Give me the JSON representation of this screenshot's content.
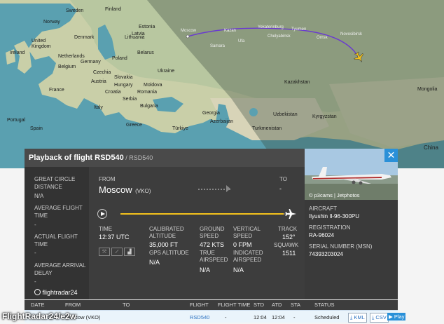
{
  "map_labels": {
    "sweden": "Sweden",
    "finland": "Finland",
    "norway": "Norway",
    "estonia": "Estonia",
    "denmark": "Denmark",
    "latvia": "Latvia",
    "lithuania": "Lithuania",
    "united_kingdom": "United\nKingdom",
    "ireland": "Ireland",
    "netherlands": "Netherlands",
    "belarus": "Belarus",
    "poland": "Poland",
    "germany": "Germany",
    "belgium": "Belgium",
    "czechia": "Czechia",
    "ukraine": "Ukraine",
    "slovakia": "Slovakia",
    "austria": "Austria",
    "hungary": "Hungary",
    "moldova": "Moldova",
    "france": "France",
    "croatia": "Croatia",
    "romania": "Romania",
    "serbia": "Serbia",
    "bulgaria": "Bulgaria",
    "italy": "Italy",
    "portugal": "Portugal",
    "spain": "Spain",
    "greece": "Greece",
    "turkiye": "Türkiye",
    "georgia": "Georgia",
    "azerbaijan": "Azerbaijan",
    "turkmenistan": "Turkmenistan",
    "uzbekistan": "Uzbekistan",
    "kyrgyzstan": "Kyrgyzstan",
    "kazakhstan": "Kazakhstan",
    "mongolia": "Mongolia",
    "china": "China",
    "moscow": "Moscow",
    "kazan": "Kazan",
    "yekaterinburg": "Yekaterinburg",
    "chelyabinsk": "Chelyabinsk",
    "tyumen": "Tyumen",
    "omsk": "Omsk",
    "novosibirsk": "Novosibirsk",
    "ufa": "Ufa",
    "samara": "Samara"
  },
  "panel": {
    "title": "Playback of flight RSD540",
    "callsign": " / RSD540",
    "close_symbol": "✕",
    "photo_credit": "© p3cams | Jetphotos",
    "left": {
      "great_circle_label": "GREAT CIRCLE DISTANCE",
      "great_circle_value": "N/A",
      "avg_flight_label": "AVERAGE FLIGHT TIME",
      "avg_flight_value": "-",
      "actual_flight_label": "ACTUAL FLIGHT TIME",
      "actual_flight_value": "-",
      "avg_arrival_label": "AVERAGE ARRIVAL DELAY",
      "avg_arrival_value": "-"
    },
    "logo_text": "flightradar24",
    "from_label": "FROM",
    "from_city": "Moscow",
    "from_code": "(VKO)",
    "to_label": "TO",
    "to_value": "-",
    "progress": 0.97,
    "time_label": "TIME",
    "time_value": "12:37 UTC",
    "calibrated_altitude_label": "CALIBRATED ALTITUDE",
    "calibrated_altitude_value": "35,000 FT",
    "gps_altitude_label": "GPS ALTITUDE",
    "gps_altitude_value": "N/A",
    "ground_speed_label": "GROUND SPEED",
    "ground_speed_value": "472 KTS",
    "true_airspeed_label": "TRUE AIRSPEED",
    "true_airspeed_value": "N/A",
    "vertical_speed_label": "VERTICAL SPEED",
    "vertical_speed_value": "0 FPM",
    "indicated_airspeed_label": "INDICATED AIRSPEED",
    "indicated_airspeed_value": "N/A",
    "track_label": "TRACK",
    "track_value": "152°",
    "squawk_label": "SQUAWK",
    "squawk_value": "1511",
    "aircraft_label": "AIRCRAFT",
    "aircraft_value": "Ilyushin Il-96-300PU",
    "registration_label": "REGISTRATION",
    "registration_value": "RA-96024",
    "serial_label": "SERIAL NUMBER (MSN)",
    "serial_value": "74393203024"
  },
  "table": {
    "headers": [
      "DATE",
      "FROM",
      "TO",
      "FLIGHT",
      "FLIGHT TIME",
      "STD",
      "ATD",
      "STA",
      "STATUS"
    ],
    "row": {
      "date": "12 Jun 2024",
      "from": "Moscow (VKO)",
      "to": "",
      "flight": "RSD540",
      "flight_time": "-",
      "std": "12:04",
      "atd": "12:04",
      "sta": "-",
      "status": "Scheduled",
      "actions": [
        "KML",
        "CSV",
        "Play"
      ]
    }
  },
  "watermark": "FlightRadar24/e2w",
  "colors": {
    "accent": "#2a90d8",
    "route": "#6a3ad0",
    "progress": "#f4c21c",
    "panel_bg": "#3d3d3d"
  }
}
